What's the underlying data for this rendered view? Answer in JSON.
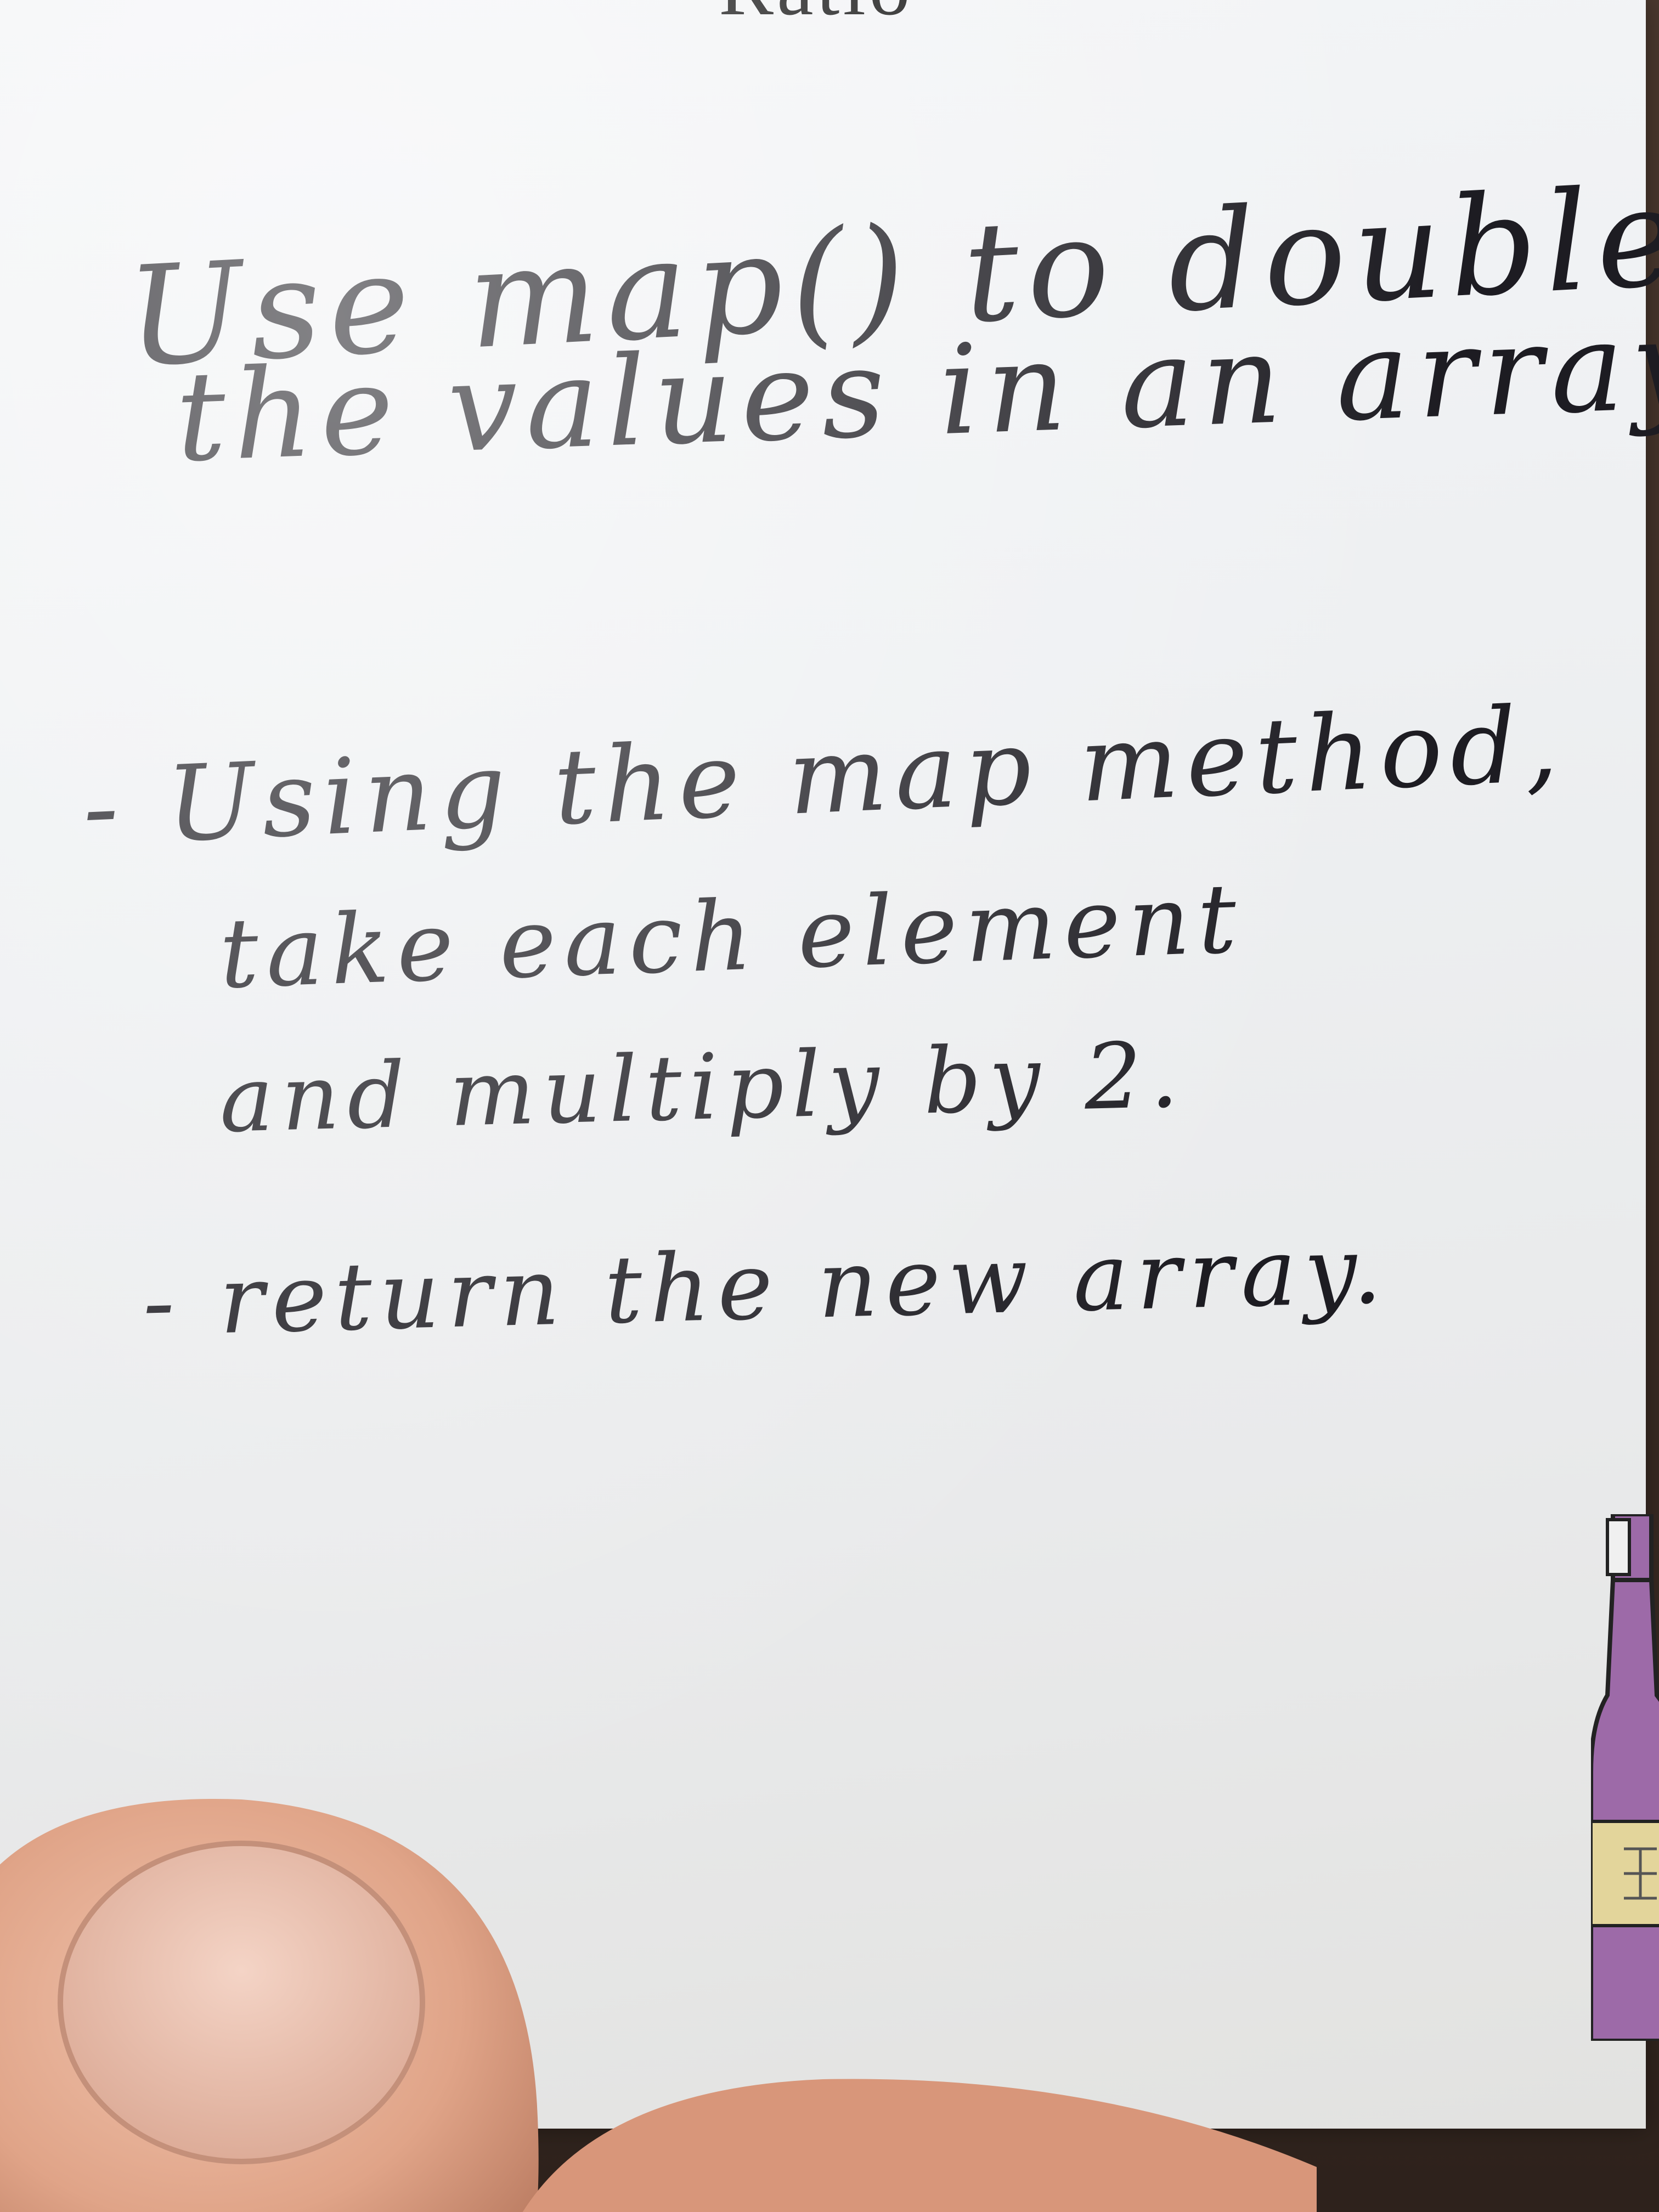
{
  "card": {
    "title_partial": "Ratio",
    "line1": "Use map() to double",
    "line2": "the values in an array.",
    "line3": "- Using the map method,",
    "line4": "take each element",
    "line5": "and multiply by 2.",
    "line6": "- return the new array."
  },
  "colors": {
    "paper": "#eef0f2",
    "ink": "#1d1c22",
    "bottle": "#9d6aa8",
    "skin": "#e6a98f",
    "background": "#3a2a22"
  },
  "icons": {
    "sticker": "bottle-sticker-icon",
    "hand": "thumb-icon"
  }
}
